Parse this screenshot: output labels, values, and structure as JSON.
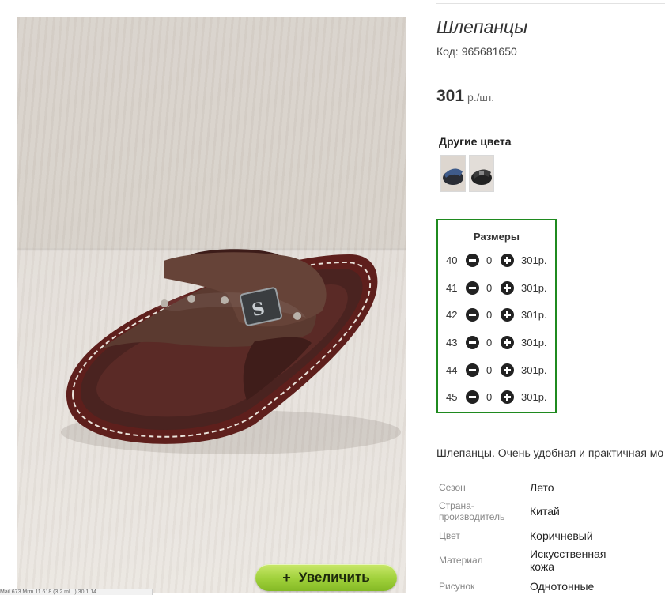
{
  "product": {
    "title": "Шлепанцы",
    "code_label": "Код:",
    "code_value": "965681650",
    "price": "301",
    "price_currency": "р.",
    "price_unit": "/шт."
  },
  "other_colors": {
    "title": "Другие цвета",
    "swatches": [
      {
        "name": "blue-black-slipper"
      },
      {
        "name": "black-slipper"
      }
    ]
  },
  "sizes": {
    "title": "Размеры",
    "rows": [
      {
        "size": "40",
        "qty": "0",
        "price": "301р."
      },
      {
        "size": "41",
        "qty": "0",
        "price": "301р."
      },
      {
        "size": "42",
        "qty": "0",
        "price": "301р."
      },
      {
        "size": "43",
        "qty": "0",
        "price": "301р."
      },
      {
        "size": "44",
        "qty": "0",
        "price": "301р."
      },
      {
        "size": "45",
        "qty": "0",
        "price": "301р."
      }
    ],
    "accent_color": "#1f8a1f"
  },
  "description": "Шлепанцы. Очень удобная и практичная мо",
  "properties": [
    {
      "key": "Сезон",
      "value": "Лето"
    },
    {
      "key": "Страна-производитель",
      "value": "Китай"
    },
    {
      "key": "Цвет",
      "value": "Коричневый"
    },
    {
      "key": "Материал",
      "value": "Искусственная кожа"
    },
    {
      "key": "Рисунок",
      "value": "Однотонные"
    }
  ],
  "image": {
    "zoom_label": "Увеличить",
    "zoom_icon": "plus-icon"
  },
  "status_strip": "Mail 673 Mrm 11 618 (3.2 ml...) 30.1 14"
}
